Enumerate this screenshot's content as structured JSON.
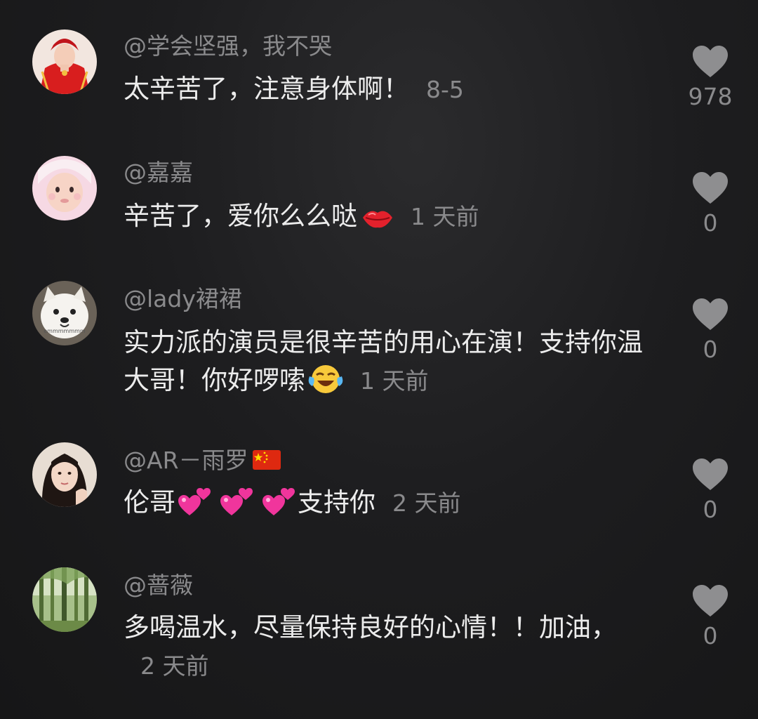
{
  "comments": [
    {
      "username": "@学会坚强，我不哭",
      "text": "太辛苦了，注意身体啊！",
      "time": "8-5",
      "likes": "978",
      "avatar_icon": "bride-avatar",
      "emojis": []
    },
    {
      "username": "@嘉嘉",
      "text": "辛苦了，爱你么么哒",
      "time": "1 天前",
      "likes": "0",
      "avatar_icon": "baby-avatar",
      "emojis": [
        "kiss-lips-emoji"
      ]
    },
    {
      "username": "@lady裙裙",
      "text": "实力派的演员是很辛苦的用心在演！支持你温大哥！你好啰嗦",
      "time": "1 天前",
      "likes": "0",
      "avatar_icon": "samoyed-dog-avatar",
      "avatar_caption": "emmmmmmm",
      "emojis": [
        "laughing-tears-emoji"
      ]
    },
    {
      "username": "@AR－雨罗",
      "text_before": "伦哥",
      "text_after": "支持你",
      "time": "2 天前",
      "likes": "0",
      "avatar_icon": "woman-portrait-avatar",
      "emojis": [
        "two-hearts-emoji",
        "two-hearts-emoji",
        "two-hearts-emoji"
      ],
      "flag_icon": "china-flag-icon"
    },
    {
      "username": "@蔷薇",
      "text": "多喝温水，尽量保持良好的心情！！加油，",
      "time": "2 天前",
      "likes": "0",
      "avatar_icon": "bamboo-forest-avatar",
      "emojis": []
    }
  ],
  "colors": {
    "background": "#1d1d1f",
    "username": "#8a8a8c",
    "text": "#ececec",
    "like_icon": "#8e8e90"
  }
}
